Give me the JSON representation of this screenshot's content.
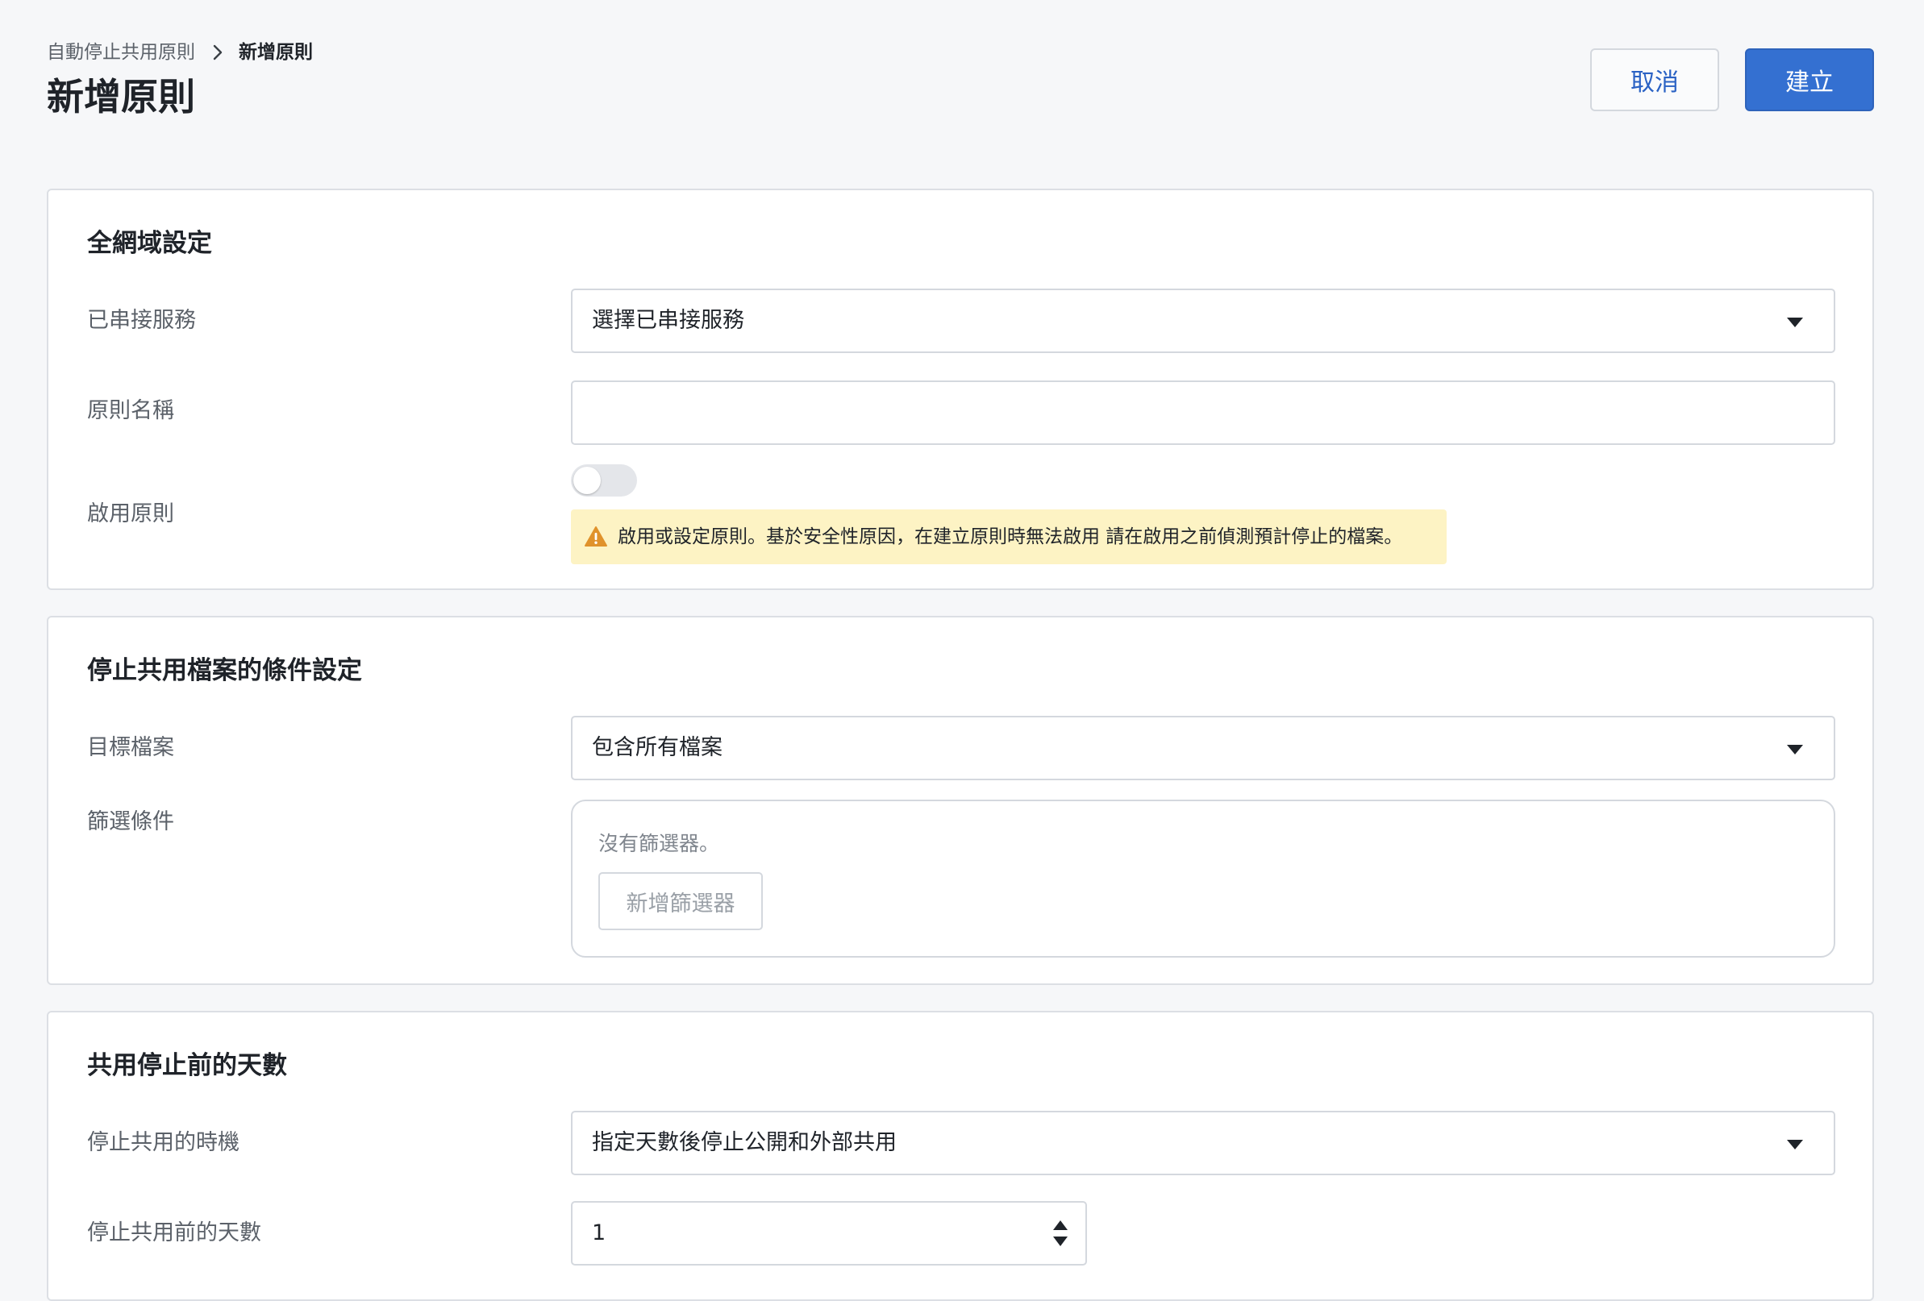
{
  "breadcrumb": {
    "parent": "自動停止共用原則",
    "current": "新增原則"
  },
  "page_title": "新增原則",
  "header_buttons": {
    "cancel": "取消",
    "create": "建立"
  },
  "sections": {
    "global": {
      "title": "全網域設定",
      "connected_service_label": "已串接服務",
      "connected_service_value": "選擇已串接服務",
      "policy_name_label": "原則名稱",
      "policy_name_value": "",
      "enable_policy_label": "啟用原則",
      "enable_policy_on": false,
      "warning_text": "啟用或設定原則。基於安全性原因，在建立原則時無法啟用 請在啟用之前偵測預計停止的檔案。"
    },
    "conditions": {
      "title": "停止共用檔案的條件設定",
      "target_files_label": "目標檔案",
      "target_files_value": "包含所有檔案",
      "filter_label": "篩選條件",
      "no_filters_text": "沒有篩選器。",
      "add_filter_button": "新增篩選器"
    },
    "days": {
      "title": "共用停止前的天數",
      "timing_label": "停止共用的時機",
      "timing_value": "指定天數後停止公開和外部共用",
      "days_label": "停止共用前的天數",
      "days_value": "1"
    }
  },
  "colors": {
    "primary": "#3470d1",
    "warning_bg": "#fdf3c4",
    "warning_icon": "#e0922b"
  }
}
